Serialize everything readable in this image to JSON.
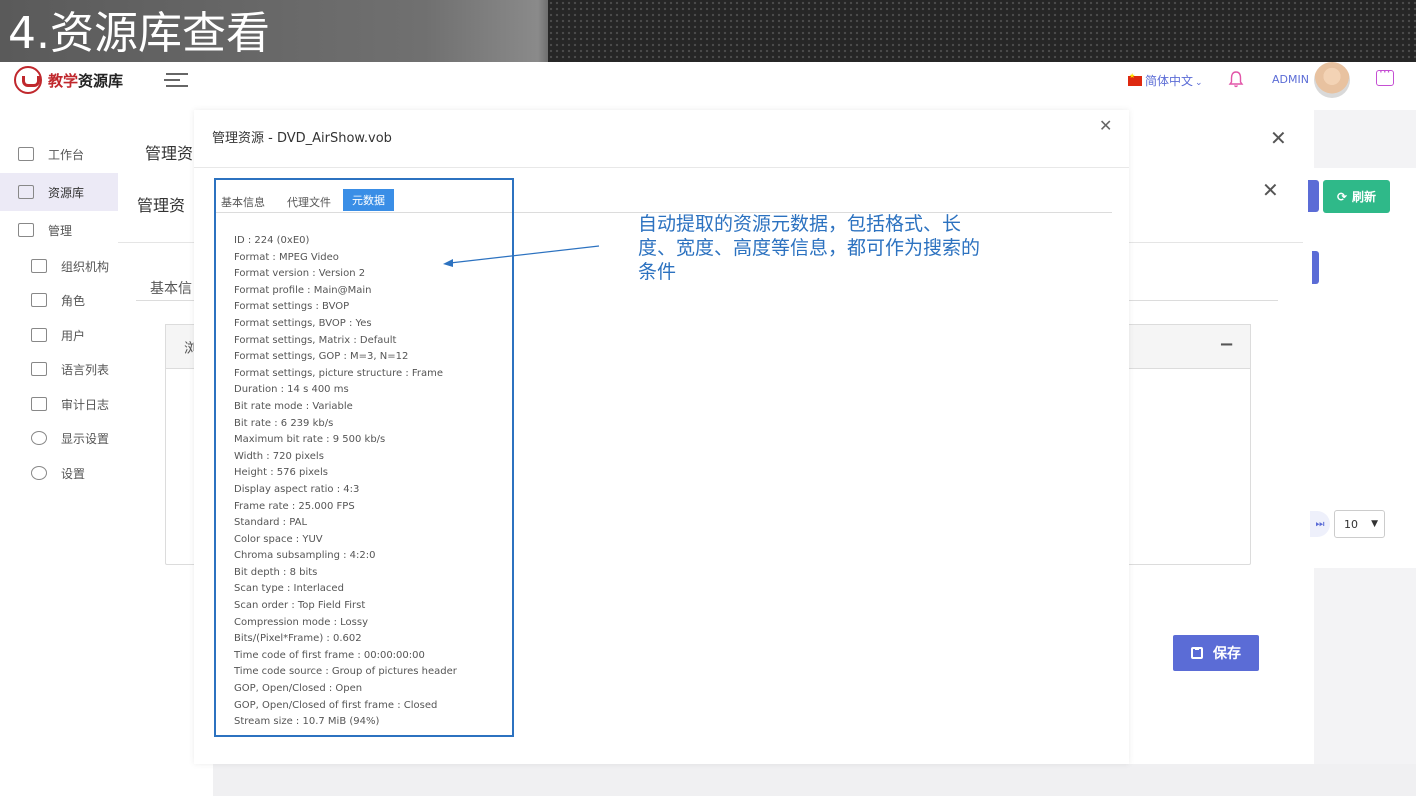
{
  "slide": {
    "title": "4.资源库查看"
  },
  "header": {
    "app_name_accent": "教学",
    "app_name_rest": "资源库",
    "language": "简体中文",
    "user": "ADMIN"
  },
  "sidebar": {
    "items": [
      {
        "label": "工作台",
        "icon": "trend-icon"
      },
      {
        "label": "资源库",
        "icon": "add-folder-icon"
      },
      {
        "label": "管理",
        "icon": "manage-icon"
      }
    ],
    "sub_items": [
      {
        "label": "组织机构",
        "icon": "org-icon"
      },
      {
        "label": "角色",
        "icon": "role-icon"
      },
      {
        "label": "用户",
        "icon": "user-icon"
      },
      {
        "label": "语言列表",
        "icon": "language-icon"
      },
      {
        "label": "审计日志",
        "icon": "audit-icon"
      },
      {
        "label": "显示设置",
        "icon": "eye-icon"
      },
      {
        "label": "设置",
        "icon": "gear-icon"
      }
    ]
  },
  "background_page": {
    "title1": "管理资",
    "title2": "管理资",
    "tab": "基本信",
    "box_head": "浏",
    "refresh_label": "刷新",
    "page_size": "10",
    "save_label": "保存"
  },
  "modal": {
    "title": "管理资源 - DVD_AirShow.vob",
    "tabs": [
      "基本信息",
      "代理文件",
      "元数据"
    ],
    "active_tab": "元数据",
    "metadata": [
      "ID : 224 (0xE0)",
      "Format : MPEG Video",
      "Format version : Version 2",
      "Format profile : Main@Main",
      "Format settings : BVOP",
      "Format settings, BVOP : Yes",
      "Format settings, Matrix : Default",
      "Format settings, GOP : M=3, N=12",
      "Format settings, picture structure : Frame",
      "Duration : 14 s 400 ms",
      "Bit rate mode : Variable",
      "Bit rate : 6 239 kb/s",
      "Maximum bit rate : 9 500 kb/s",
      "Width : 720 pixels",
      "Height : 576 pixels",
      "Display aspect ratio : 4:3",
      "Frame rate : 25.000 FPS",
      "Standard : PAL",
      "Color space : YUV",
      "Chroma subsampling : 4:2:0",
      "Bit depth : 8 bits",
      "Scan type : Interlaced",
      "Scan order : Top Field First",
      "Compression mode : Lossy",
      "Bits/(Pixel*Frame) : 0.602",
      "Time code of first frame : 00:00:00:00",
      "Time code source : Group of pictures header",
      "GOP, Open/Closed : Open",
      "GOP, Open/Closed of first frame : Closed",
      "Stream size : 10.7 MiB (94%)"
    ]
  },
  "annotation": {
    "callout": "自动提取的资源元数据，包括格式、长度、宽度、高度等信息，都可作为搜索的条件"
  }
}
